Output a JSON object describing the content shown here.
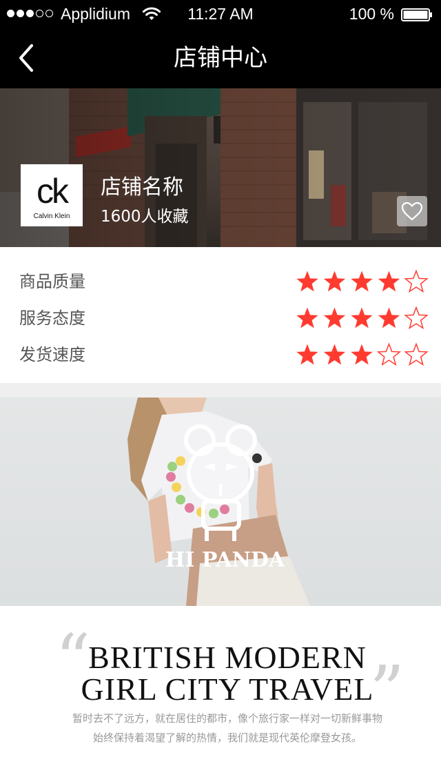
{
  "status_bar": {
    "carrier": "Applidium",
    "time": "11:27 AM",
    "battery_percent": "100 %",
    "signal_icons": [
      "dot-filled",
      "dot-filled",
      "dot-filled",
      "dot-empty",
      "dot-empty"
    ],
    "wifi_icon": "wifi-icon",
    "battery_icon": "battery-full-icon"
  },
  "nav": {
    "back_icon": "chevron-left-icon",
    "title": "店铺中心"
  },
  "shop": {
    "logo_mark": "ck",
    "logo_sub": "Calvin Klein",
    "name": "店铺名称",
    "favorites": "1600人收藏",
    "favorite_icon": "heart-outline-icon"
  },
  "ratings": [
    {
      "label": "商品质量",
      "score": 4,
      "max": 5
    },
    {
      "label": "服务态度",
      "score": 4,
      "max": 5
    },
    {
      "label": "发货速度",
      "score": 3,
      "max": 5
    }
  ],
  "product_banner": {
    "brand": "HI PANDA"
  },
  "tagline": {
    "headline_1": "BRITISH MODERN",
    "headline_2": "GIRL CITY TRAVEL",
    "open_quote": "“",
    "close_quote": "”",
    "description_1": "暂时去不了远方，就在居住的都市，像个旅行家一样对一切新鲜事物",
    "description_2": "始终保持着渴望了解的热情，我们就是现代英伦摩登女孩。"
  },
  "colors": {
    "star_filled": "#ff3b30",
    "star_empty": "#ff3b30",
    "header_bg": "#000000",
    "divider_bg": "#efefef"
  }
}
